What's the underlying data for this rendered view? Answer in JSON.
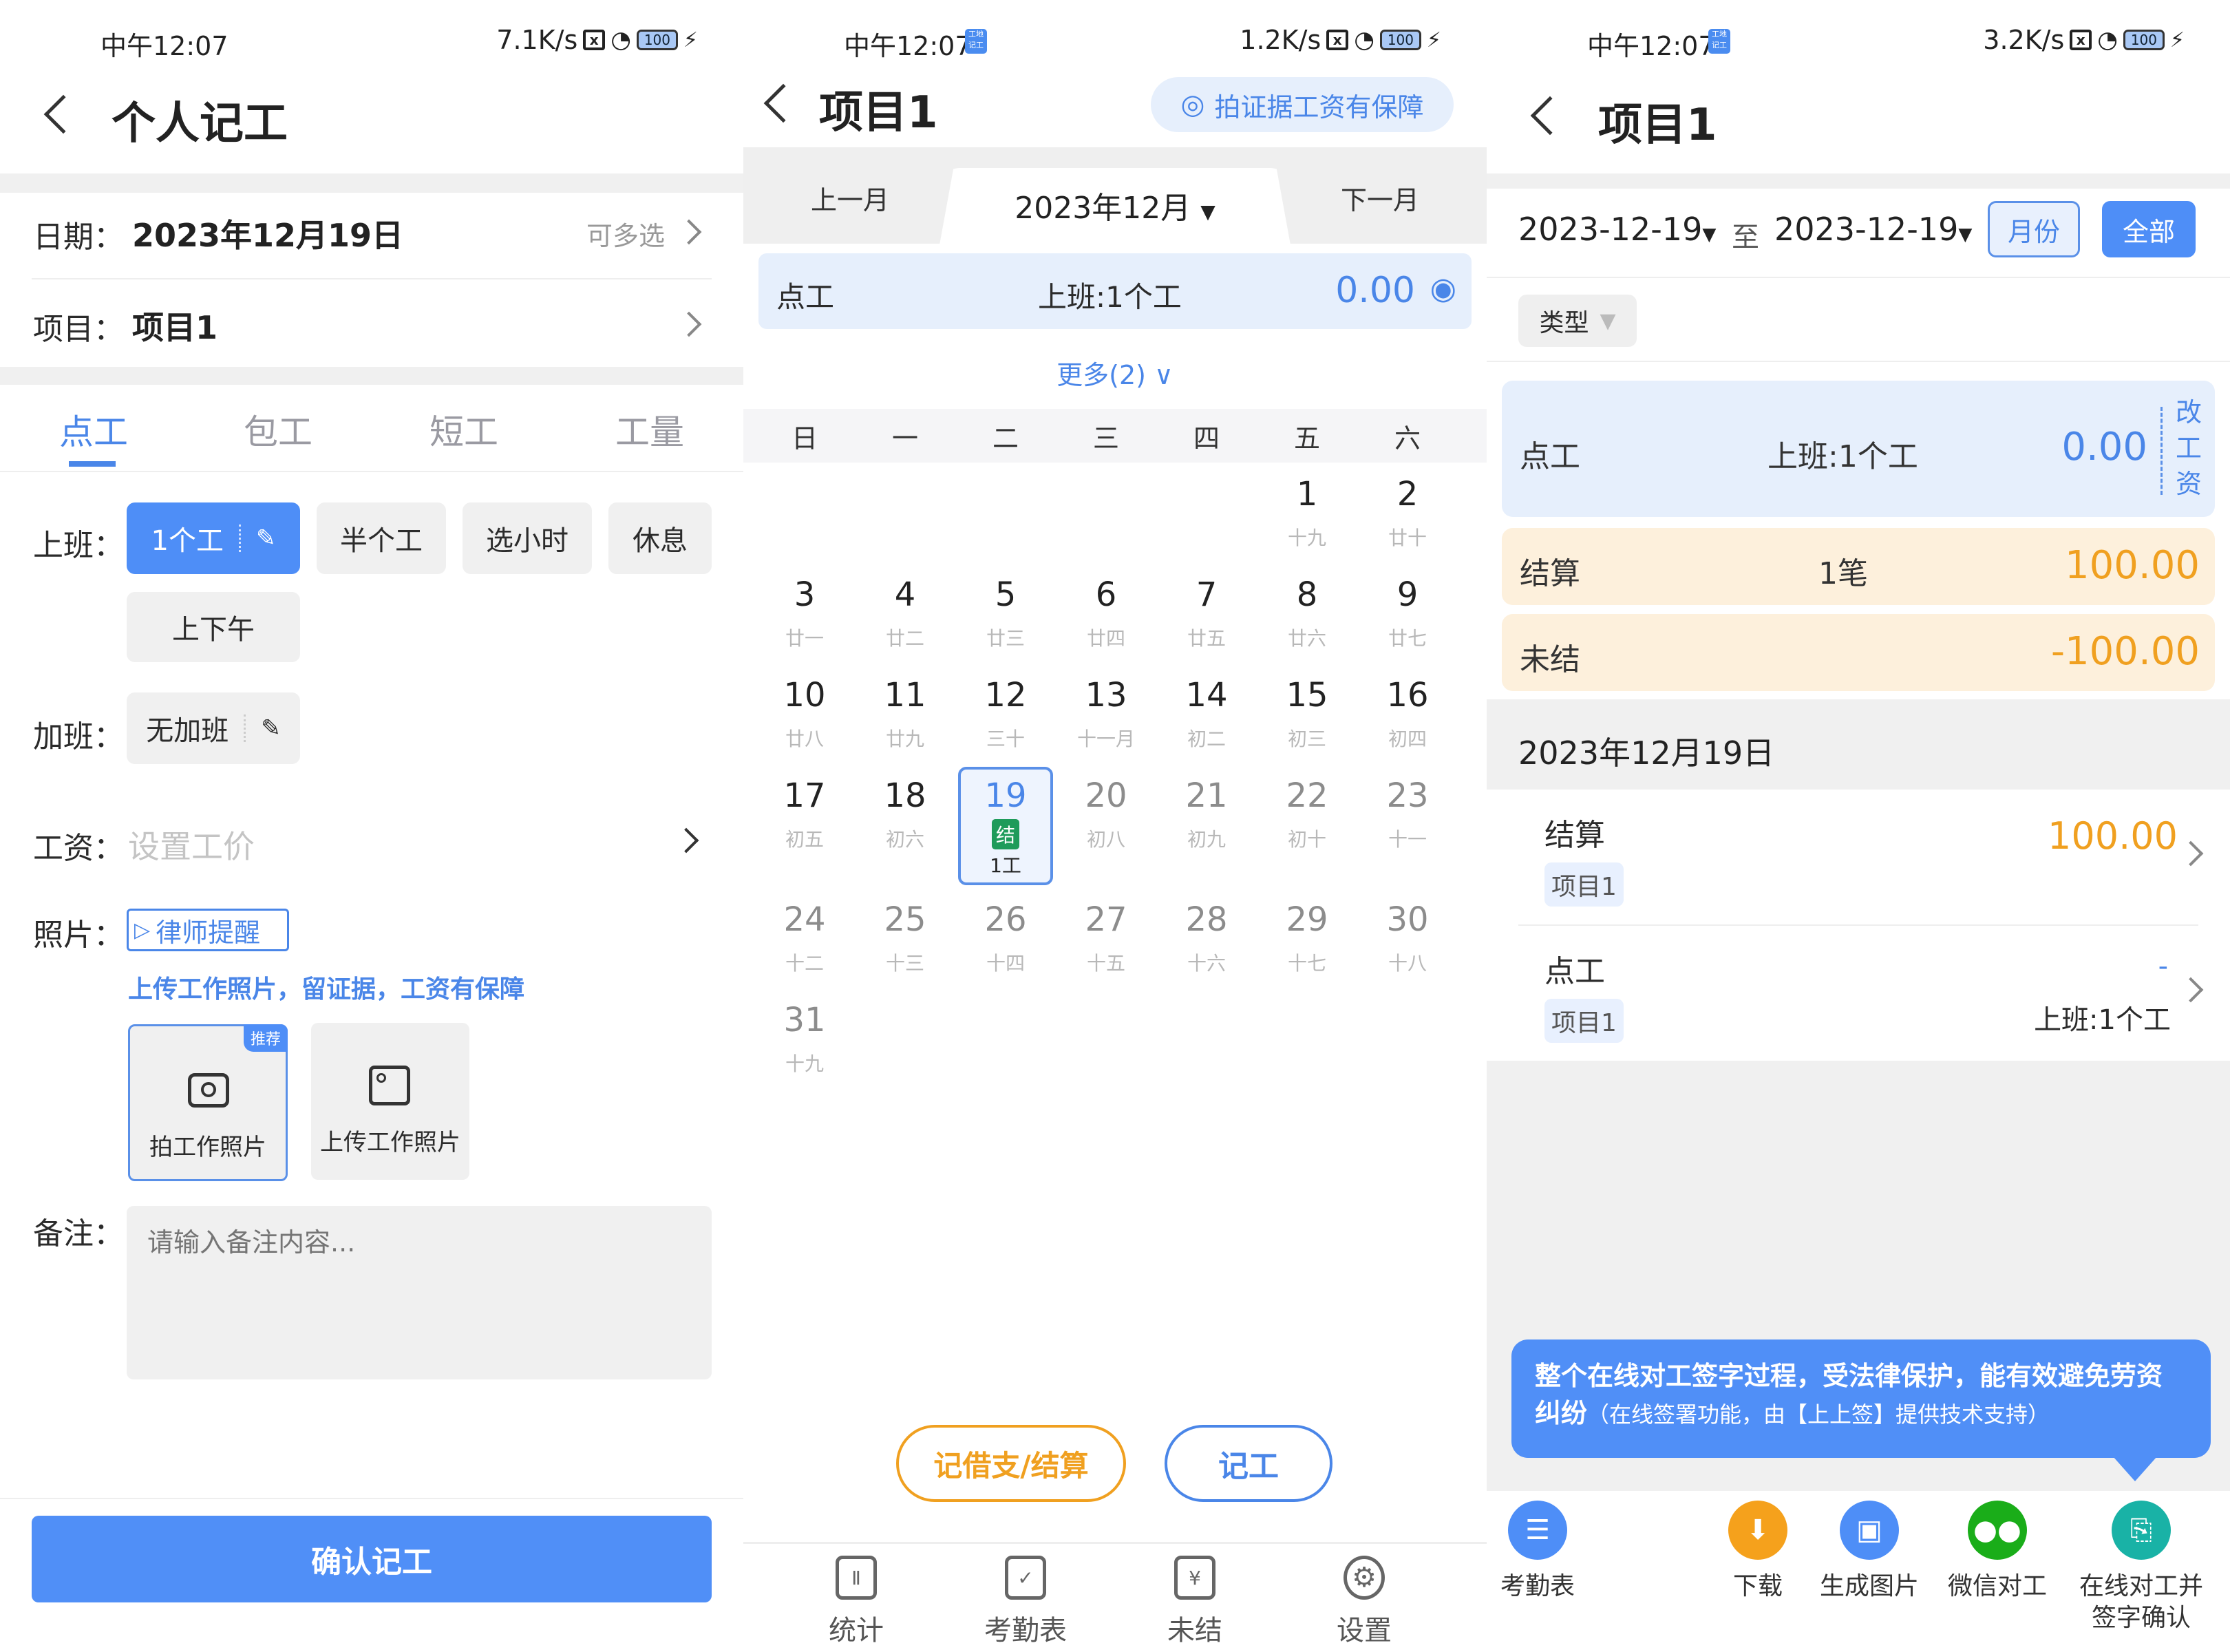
{
  "panels": {
    "left": {
      "status": {
        "time": "中午12:07",
        "speed": "7.1K/s",
        "battery": "100"
      },
      "header": {
        "title": "个人记工"
      },
      "date_row": {
        "label": "日期：",
        "value": "2023年12月19日",
        "hint": "可多选"
      },
      "project_row": {
        "label": "项目：",
        "value": "项目1"
      },
      "tabs": [
        {
          "label": "点工",
          "active": true
        },
        {
          "label": "包工",
          "active": false
        },
        {
          "label": "短工",
          "active": false
        },
        {
          "label": "工量",
          "active": false
        }
      ],
      "work": {
        "label": "上班：",
        "options": [
          "1个工",
          "半个工",
          "选小时",
          "休息",
          "上下午"
        ],
        "selected": "1个工"
      },
      "overtime": {
        "label": "加班：",
        "value": "无加班"
      },
      "wage": {
        "label": "工资：",
        "placeholder": "设置工价"
      },
      "photo": {
        "label": "照片：",
        "lawyer_link": "律师提醒",
        "hint": "上传工作照片，留证据，工资有保障",
        "take_photo": "拍工作照片",
        "recommend_badge": "推荐",
        "upload_photo": "上传工作照片"
      },
      "remark": {
        "label": "备注：",
        "placeholder": "请输入备注内容..."
      },
      "confirm_button": "确认记工"
    },
    "middle": {
      "status": {
        "time": "中午12:07",
        "speed": "1.2K/s",
        "battery": "100",
        "app_icon_text": "工地记工"
      },
      "header": {
        "title": "项目1",
        "evidence_button": "拍证据工资有保障"
      },
      "month_nav": {
        "prev": "上一月",
        "current": "2023年12月",
        "next": "下一月"
      },
      "summary": {
        "type": "点工",
        "detail": "上班:1个工",
        "amount": "0.00"
      },
      "more": "更多(2)",
      "weekdays": [
        "日",
        "一",
        "二",
        "三",
        "四",
        "五",
        "六"
      ],
      "days": [
        {
          "d": "1",
          "l": "十九"
        },
        {
          "d": "2",
          "l": "廿十"
        },
        {
          "d": "3",
          "l": "廿一"
        },
        {
          "d": "4",
          "l": "廿二"
        },
        {
          "d": "5",
          "l": "廿三"
        },
        {
          "d": "6",
          "l": "廿四"
        },
        {
          "d": "7",
          "l": "廿五"
        },
        {
          "d": "8",
          "l": "廿六"
        },
        {
          "d": "9",
          "l": "廿七"
        },
        {
          "d": "10",
          "l": "廿八"
        },
        {
          "d": "11",
          "l": "廿九"
        },
        {
          "d": "12",
          "l": "三十"
        },
        {
          "d": "13",
          "l": "十一月"
        },
        {
          "d": "14",
          "l": "初二"
        },
        {
          "d": "15",
          "l": "初三"
        },
        {
          "d": "16",
          "l": "初四"
        },
        {
          "d": "17",
          "l": "初五"
        },
        {
          "d": "18",
          "l": "初六"
        },
        {
          "d": "19",
          "l": "",
          "badge": "结",
          "note": "1工",
          "selected": true
        },
        {
          "d": "20",
          "l": "初八"
        },
        {
          "d": "21",
          "l": "初九"
        },
        {
          "d": "22",
          "l": "初十"
        },
        {
          "d": "23",
          "l": "十一"
        },
        {
          "d": "24",
          "l": "十二"
        },
        {
          "d": "25",
          "l": "十三"
        },
        {
          "d": "26",
          "l": "十四"
        },
        {
          "d": "27",
          "l": "十五"
        },
        {
          "d": "28",
          "l": "十六"
        },
        {
          "d": "29",
          "l": "十七"
        },
        {
          "d": "30",
          "l": "十八"
        },
        {
          "d": "31",
          "l": "十九"
        }
      ],
      "first_weekday": 5,
      "today": 19,
      "buttons": {
        "borrow_settle": "记借支/结算",
        "record": "记工"
      },
      "bottom_nav": [
        {
          "label": "统计",
          "icon": "chart-icon"
        },
        {
          "label": "考勤表",
          "icon": "attendance-icon"
        },
        {
          "label": "未结",
          "icon": "unsettled-icon"
        },
        {
          "label": "设置",
          "icon": "gear-icon"
        }
      ]
    },
    "right": {
      "status": {
        "time": "中午12:07",
        "speed": "3.2K/s",
        "battery": "100",
        "app_icon_text": "工地记工"
      },
      "header": {
        "title": "项目1"
      },
      "filter": {
        "start": "2023-12-19",
        "to": "至",
        "end": "2023-12-19",
        "month_button": "月份",
        "all_button": "全部",
        "type_chip": "类型"
      },
      "cards": {
        "work": {
          "type": "点工",
          "detail": "上班:1个工",
          "amount": "0.00",
          "edit": "改工资"
        },
        "settle": {
          "type": "结算",
          "detail": "1笔",
          "amount": "100.00"
        },
        "unsettled": {
          "type": "未结",
          "amount": "-100.00"
        }
      },
      "date_heading": "2023年12月19日",
      "records": [
        {
          "type": "结算",
          "project": "项目1",
          "amount": "100.00",
          "detail": ""
        },
        {
          "type": "点工",
          "project": "项目1",
          "amount": "-",
          "detail": "上班:1个工"
        }
      ],
      "tooltip": {
        "main": "整个在线对工签字过程，受法律保护，能有效避免劳资纠纷",
        "sub": "（在线签署功能，由【上上签】提供技术支持）"
      },
      "actions": [
        {
          "label": "考勤表",
          "color": "#4e8ef7"
        },
        {
          "label": "下载",
          "color": "#f5a11c"
        },
        {
          "label": "生成图片",
          "color": "#4e8ef7"
        },
        {
          "label": "微信对工",
          "color": "#1aad19"
        },
        {
          "label": "在线对工并签字确认",
          "color": "#19b2a6"
        }
      ]
    }
  },
  "colors": {
    "accent": "#4e8ef7",
    "orange": "#f0a020",
    "green": "#1e9b5a",
    "light_blue": "#e8f0fd",
    "light_orange": "#fdf0dc"
  }
}
